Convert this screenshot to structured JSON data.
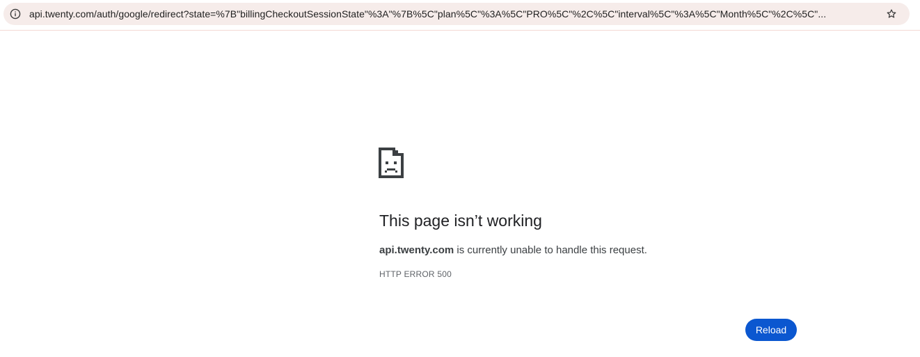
{
  "browser": {
    "address_bar": {
      "url": "api.twenty.com/auth/google/redirect?state=%7B\"billingCheckoutSessionState\"%3A\"%7B%5C\"plan%5C\"%3A%5C\"PRO%5C\"%2C%5C\"interval%5C\"%3A%5C\"Month%5C\"%2C%5C\"...",
      "info_icon": "info-circle-icon",
      "bookmark_icon": "star-outline-icon"
    }
  },
  "error_page": {
    "icon": "sad-document-icon",
    "title": "This page isn’t working",
    "host": "api.twenty.com",
    "description_suffix": " is currently unable to handle this request.",
    "error_code": "HTTP ERROR 500",
    "reload_label": "Reload",
    "accent_color": "#0b57d0"
  }
}
